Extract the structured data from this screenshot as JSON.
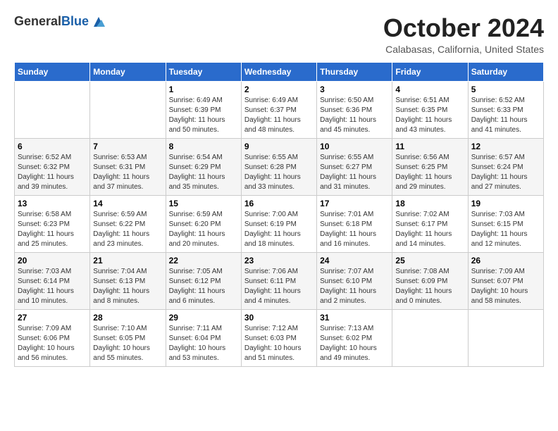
{
  "logo": {
    "general": "General",
    "blue": "Blue"
  },
  "header": {
    "month": "October 2024",
    "location": "Calabasas, California, United States"
  },
  "weekdays": [
    "Sunday",
    "Monday",
    "Tuesday",
    "Wednesday",
    "Thursday",
    "Friday",
    "Saturday"
  ],
  "weeks": [
    [
      {
        "day": "",
        "info": ""
      },
      {
        "day": "",
        "info": ""
      },
      {
        "day": "1",
        "info": "Sunrise: 6:49 AM\nSunset: 6:39 PM\nDaylight: 11 hours and 50 minutes."
      },
      {
        "day": "2",
        "info": "Sunrise: 6:49 AM\nSunset: 6:37 PM\nDaylight: 11 hours and 48 minutes."
      },
      {
        "day": "3",
        "info": "Sunrise: 6:50 AM\nSunset: 6:36 PM\nDaylight: 11 hours and 45 minutes."
      },
      {
        "day": "4",
        "info": "Sunrise: 6:51 AM\nSunset: 6:35 PM\nDaylight: 11 hours and 43 minutes."
      },
      {
        "day": "5",
        "info": "Sunrise: 6:52 AM\nSunset: 6:33 PM\nDaylight: 11 hours and 41 minutes."
      }
    ],
    [
      {
        "day": "6",
        "info": "Sunrise: 6:52 AM\nSunset: 6:32 PM\nDaylight: 11 hours and 39 minutes."
      },
      {
        "day": "7",
        "info": "Sunrise: 6:53 AM\nSunset: 6:31 PM\nDaylight: 11 hours and 37 minutes."
      },
      {
        "day": "8",
        "info": "Sunrise: 6:54 AM\nSunset: 6:29 PM\nDaylight: 11 hours and 35 minutes."
      },
      {
        "day": "9",
        "info": "Sunrise: 6:55 AM\nSunset: 6:28 PM\nDaylight: 11 hours and 33 minutes."
      },
      {
        "day": "10",
        "info": "Sunrise: 6:55 AM\nSunset: 6:27 PM\nDaylight: 11 hours and 31 minutes."
      },
      {
        "day": "11",
        "info": "Sunrise: 6:56 AM\nSunset: 6:25 PM\nDaylight: 11 hours and 29 minutes."
      },
      {
        "day": "12",
        "info": "Sunrise: 6:57 AM\nSunset: 6:24 PM\nDaylight: 11 hours and 27 minutes."
      }
    ],
    [
      {
        "day": "13",
        "info": "Sunrise: 6:58 AM\nSunset: 6:23 PM\nDaylight: 11 hours and 25 minutes."
      },
      {
        "day": "14",
        "info": "Sunrise: 6:59 AM\nSunset: 6:22 PM\nDaylight: 11 hours and 23 minutes."
      },
      {
        "day": "15",
        "info": "Sunrise: 6:59 AM\nSunset: 6:20 PM\nDaylight: 11 hours and 20 minutes."
      },
      {
        "day": "16",
        "info": "Sunrise: 7:00 AM\nSunset: 6:19 PM\nDaylight: 11 hours and 18 minutes."
      },
      {
        "day": "17",
        "info": "Sunrise: 7:01 AM\nSunset: 6:18 PM\nDaylight: 11 hours and 16 minutes."
      },
      {
        "day": "18",
        "info": "Sunrise: 7:02 AM\nSunset: 6:17 PM\nDaylight: 11 hours and 14 minutes."
      },
      {
        "day": "19",
        "info": "Sunrise: 7:03 AM\nSunset: 6:15 PM\nDaylight: 11 hours and 12 minutes."
      }
    ],
    [
      {
        "day": "20",
        "info": "Sunrise: 7:03 AM\nSunset: 6:14 PM\nDaylight: 11 hours and 10 minutes."
      },
      {
        "day": "21",
        "info": "Sunrise: 7:04 AM\nSunset: 6:13 PM\nDaylight: 11 hours and 8 minutes."
      },
      {
        "day": "22",
        "info": "Sunrise: 7:05 AM\nSunset: 6:12 PM\nDaylight: 11 hours and 6 minutes."
      },
      {
        "day": "23",
        "info": "Sunrise: 7:06 AM\nSunset: 6:11 PM\nDaylight: 11 hours and 4 minutes."
      },
      {
        "day": "24",
        "info": "Sunrise: 7:07 AM\nSunset: 6:10 PM\nDaylight: 11 hours and 2 minutes."
      },
      {
        "day": "25",
        "info": "Sunrise: 7:08 AM\nSunset: 6:09 PM\nDaylight: 11 hours and 0 minutes."
      },
      {
        "day": "26",
        "info": "Sunrise: 7:09 AM\nSunset: 6:07 PM\nDaylight: 10 hours and 58 minutes."
      }
    ],
    [
      {
        "day": "27",
        "info": "Sunrise: 7:09 AM\nSunset: 6:06 PM\nDaylight: 10 hours and 56 minutes."
      },
      {
        "day": "28",
        "info": "Sunrise: 7:10 AM\nSunset: 6:05 PM\nDaylight: 10 hours and 55 minutes."
      },
      {
        "day": "29",
        "info": "Sunrise: 7:11 AM\nSunset: 6:04 PM\nDaylight: 10 hours and 53 minutes."
      },
      {
        "day": "30",
        "info": "Sunrise: 7:12 AM\nSunset: 6:03 PM\nDaylight: 10 hours and 51 minutes."
      },
      {
        "day": "31",
        "info": "Sunrise: 7:13 AM\nSunset: 6:02 PM\nDaylight: 10 hours and 49 minutes."
      },
      {
        "day": "",
        "info": ""
      },
      {
        "day": "",
        "info": ""
      }
    ]
  ]
}
